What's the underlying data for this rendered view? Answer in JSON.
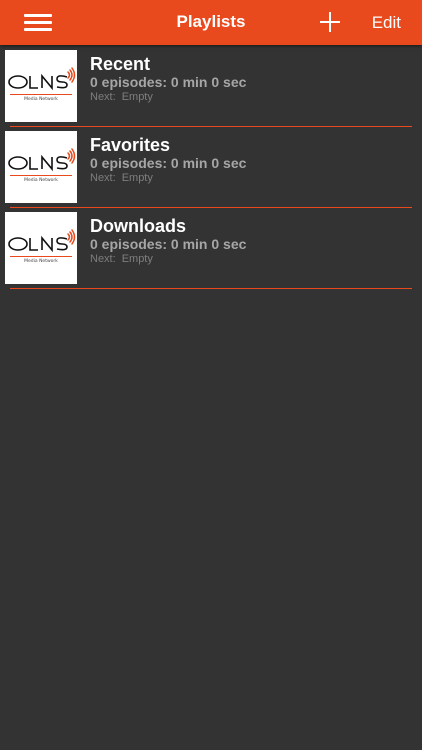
{
  "nav": {
    "title": "Playlists",
    "edit_label": "Edit",
    "icons": [
      "hamburger-menu-icon",
      "plus-icon"
    ],
    "bar_color": "#E8491D"
  },
  "playlists": [
    {
      "title": "Recent",
      "summary": "0 episodes: 0 min 0 sec",
      "next_label": "Next:",
      "next_value": "Empty"
    },
    {
      "title": "Favorites",
      "summary": "0 episodes: 0 min 0 sec",
      "next_label": "Next:",
      "next_value": "Empty"
    },
    {
      "title": "Downloads",
      "summary": "0 episodes: 0 min 0 sec",
      "next_label": "Next:",
      "next_value": "Empty"
    }
  ],
  "logo": {
    "text": "OLNS",
    "tagline": "Media Network",
    "accent_color": "#E8491D"
  },
  "theme": {
    "background": "#333333",
    "accent": "#E8491D"
  }
}
